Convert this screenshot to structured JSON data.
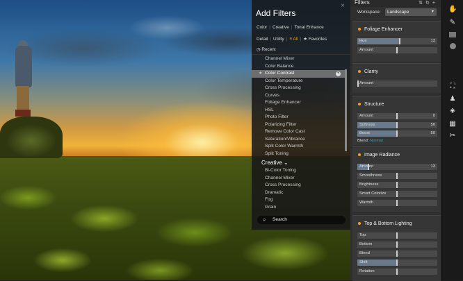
{
  "add_filters": {
    "title": "Add Filters",
    "close": "×",
    "row1": [
      "Color",
      "Creative",
      "Tonal Enhance"
    ],
    "row2": [
      "Detail",
      "Utility",
      "All",
      "Favorites"
    ],
    "recent": "Recent",
    "items": [
      "Channel Mixer",
      "Color Balance",
      "Color Contrast",
      "Color Temperature",
      "Cross Processing",
      "Curves",
      "Foliage Enhancer",
      "HSL",
      "Photo Filter",
      "Polarizing Filter",
      "Remove Color Cast",
      "Saturation/Vibrance",
      "Split Color Warmth",
      "Split Toning"
    ],
    "selected_index": 2,
    "category": "Creative",
    "creative_items": [
      "Bi-Color Toning",
      "Channel Mixer",
      "Cross Processing",
      "Dramatic",
      "Fog",
      "Grain"
    ],
    "search_placeholder": "Search"
  },
  "panel": {
    "title": "Filters",
    "workspace_label": "Workspace:",
    "workspace_value": "Landscape",
    "sections": [
      {
        "title": "Foliage Enhancer",
        "sliders": [
          {
            "label": "Hue",
            "value": "13",
            "level": 0.53
          },
          {
            "label": "Amount",
            "value": "",
            "level": 0.5
          }
        ]
      },
      {
        "title": "Clarity",
        "sliders": [
          {
            "label": "Amount",
            "value": "",
            "level": 0.0
          }
        ]
      },
      {
        "title": "Structure",
        "sliders": [
          {
            "label": "Amount",
            "value": "0",
            "level": 0.5
          },
          {
            "label": "Softness",
            "value": "50",
            "level": 0.5
          },
          {
            "label": "Boost",
            "value": "50",
            "level": 0.5
          }
        ],
        "blend_label": "Blend:",
        "blend_value": "Normal"
      },
      {
        "title": "Image Radiance",
        "sliders": [
          {
            "label": "Amount",
            "value": "13",
            "level": 0.13
          },
          {
            "label": "Smoothness",
            "value": "",
            "level": 0.5
          },
          {
            "label": "Brightness",
            "value": "",
            "level": 0.5
          },
          {
            "label": "Smart Colorize",
            "value": "",
            "level": 0.5
          },
          {
            "label": "Warmth",
            "value": "",
            "level": 0.5
          }
        ]
      },
      {
        "title": "Top & Bottom Lighting",
        "sliders": [
          {
            "label": "Top",
            "value": "",
            "level": 0.5
          },
          {
            "label": "Bottom",
            "value": "",
            "level": 0.5
          },
          {
            "label": "Blend",
            "value": "",
            "level": 0.5
          },
          {
            "label": "Shift",
            "value": "",
            "level": 0.5
          },
          {
            "label": "Rotation",
            "value": "",
            "level": 0.5
          }
        ]
      }
    ]
  },
  "tools": [
    "hand-icon",
    "brush-icon",
    "pen-icon",
    "gradient-icon",
    "radial-icon",
    "crop-icon",
    "stamp-icon",
    "eraser-icon",
    "transform-icon",
    "scissors-icon"
  ],
  "colors": {
    "accent": "#f0a020",
    "blend": "#30a0b0"
  }
}
